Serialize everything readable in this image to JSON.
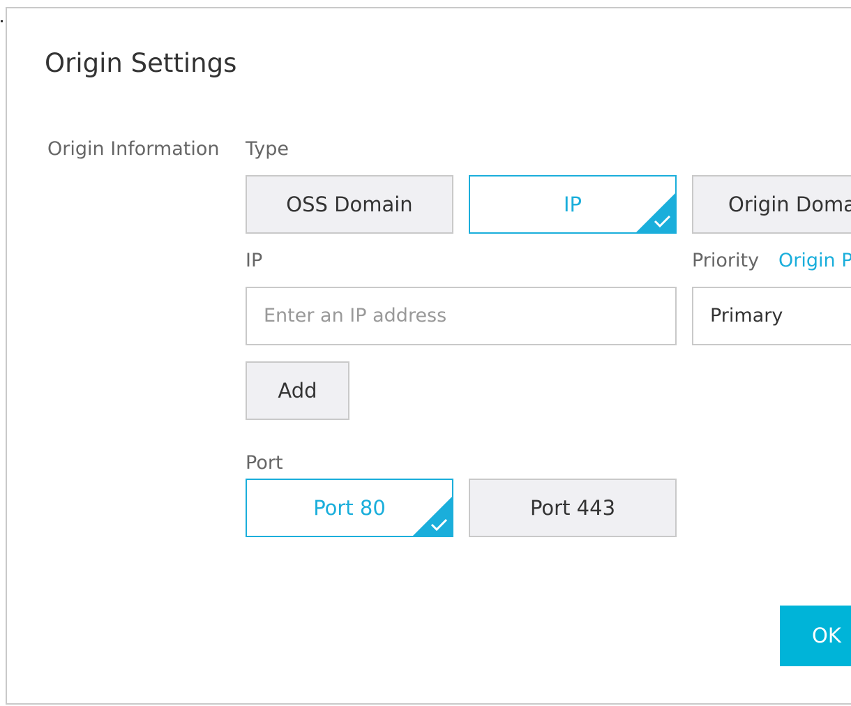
{
  "dialog": {
    "title": "Origin Settings"
  },
  "form": {
    "section_label": "Origin Information",
    "type_label": "Type",
    "type_options": [
      {
        "label": "OSS Domain",
        "selected": false
      },
      {
        "label": "IP",
        "selected": true
      },
      {
        "label": "Origin Domain",
        "selected": false
      }
    ],
    "ip_label": "IP",
    "ip_input": {
      "value": "",
      "placeholder": "Enter an IP address"
    },
    "priority_label": "Priority",
    "priority_link": "Origin Priority",
    "priority_select": {
      "value": "Primary"
    },
    "add_label": "Add",
    "port_label": "Port",
    "port_options": [
      {
        "label": "Port 80",
        "selected": true
      },
      {
        "label": "Port 443",
        "selected": false
      }
    ]
  },
  "footer": {
    "ok_label": "OK"
  },
  "colors": {
    "accent": "#1aaedb",
    "primary_button": "#00b4d8",
    "card_bg": "#f0f0f3",
    "border": "#c9c9c9"
  },
  "icons": {
    "selected_check": "check-icon"
  }
}
